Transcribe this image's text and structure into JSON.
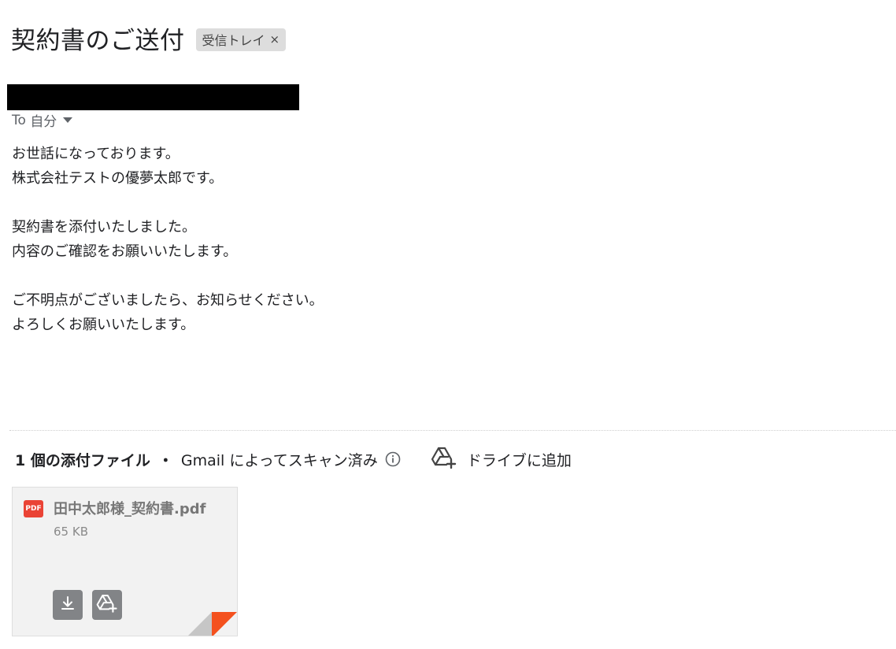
{
  "subject": "契約書のご送付",
  "label": {
    "text": "受信トレイ",
    "remove": "×"
  },
  "recipient": {
    "prefix": "To",
    "name": "自分"
  },
  "body_lines": [
    "お世話になっております。",
    "株式会社テストの優夢太郎です。",
    "",
    "契約書を添付いたしました。",
    "内容のご確認をお願いいたします。",
    "",
    "ご不明点がございましたら、お知らせください。",
    "よろしくお願いいたします。"
  ],
  "attachments_header": {
    "count": "1 個の添付ファイル",
    "separator": "・",
    "scan_text": "Gmail によってスキャン済み",
    "drive_add": "ドライブに追加"
  },
  "attachment": {
    "type_badge": "PDF",
    "file_name": "田中太郎様_契約書.pdf",
    "file_size": "65 KB"
  },
  "icons": {
    "info": "info-icon",
    "drive_add": "drive-add-icon",
    "download": "download-icon",
    "save_to_drive": "drive-add-icon"
  },
  "colors": {
    "pdf_red": "#ea4335",
    "card_bg": "#f2f2f2",
    "button_gray": "#828487"
  }
}
